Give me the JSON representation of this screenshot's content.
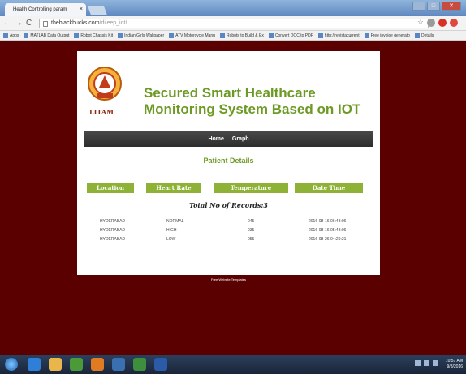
{
  "browser": {
    "tab_title": "Health Controlling param",
    "tab_close": "×",
    "url_host": "theblackbucks.com",
    "url_path": "/dileep_iot/",
    "bookmarks": [
      "Apps",
      "MATLAB Data Output",
      "Robot Chassis Kit",
      "Indian Girls Wallpaper",
      "ATV Motorcycle Manu",
      "Robots to Build & Ex",
      "Convert DOC to PDF",
      "http://revistacurrent",
      "Free invoice generato",
      "Details"
    ]
  },
  "page": {
    "logo_text": "LITAM",
    "title": "Secured Smart Healthcare Monitoring System Based on IOT",
    "nav": [
      "Home",
      "Graph"
    ],
    "section_title": "Patient Details",
    "table_headers": [
      "Location",
      "Heart Rate",
      "Temperature",
      "Date Time"
    ],
    "total_records": "Total No of Records:3",
    "rows": [
      [
        "HYDERABAD",
        "NORMAL",
        "045",
        "2016-08-16 06:43:06"
      ],
      [
        "HYDERABAD",
        "HIGH",
        "035",
        "2016-08-16 05:43:06"
      ],
      [
        "HYDERABAD",
        "LOW",
        "055",
        "2016-08-26 04:29:21"
      ]
    ],
    "footer": "Free Website Templates"
  },
  "taskbar": {
    "time": "10:57 AM",
    "date": "9/8/2016"
  },
  "colors": {
    "accent_green": "#8db236",
    "title_green": "#6d9a24",
    "background": "#5b0000"
  }
}
